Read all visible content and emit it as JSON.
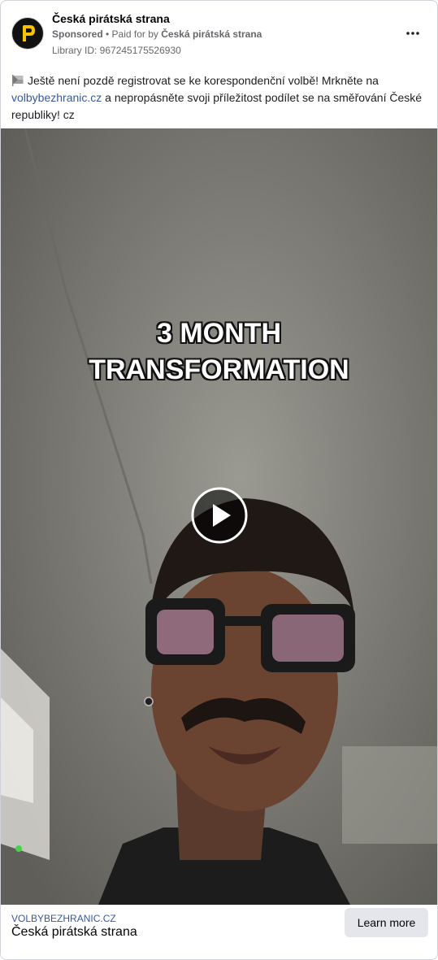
{
  "post": {
    "page_name": "Česká pirátská strana",
    "sponsored": "Sponsored",
    "paid_for_prefix": "• Paid for by",
    "paid_for_by": "Česká pirátská strana",
    "library_id": "Library ID: 967245175526930",
    "more_icon": "more-horizontal-icon",
    "body_part1": "Ještě není pozdě registrovat se ke korespondenční volbě! Mrkněte na",
    "body_link": "volbybezhranic.cz",
    "body_part2": "a nepropásněte svoji příležitost podílet se na směřování České republiky! cz",
    "body_icon": "czech-flag-icon"
  },
  "media": {
    "overlay_line1": "3 MONTH",
    "overlay_line2": "TRANSFORMATION",
    "play_icon": "play-icon"
  },
  "footer": {
    "url": "VOLBYBEZHRANIC.CZ",
    "title": "Česká pirátská strana",
    "cta_label": "Learn more"
  },
  "colors": {
    "link": "#385898",
    "cta_bg": "#e4e6eb",
    "muted": "#65676b"
  }
}
